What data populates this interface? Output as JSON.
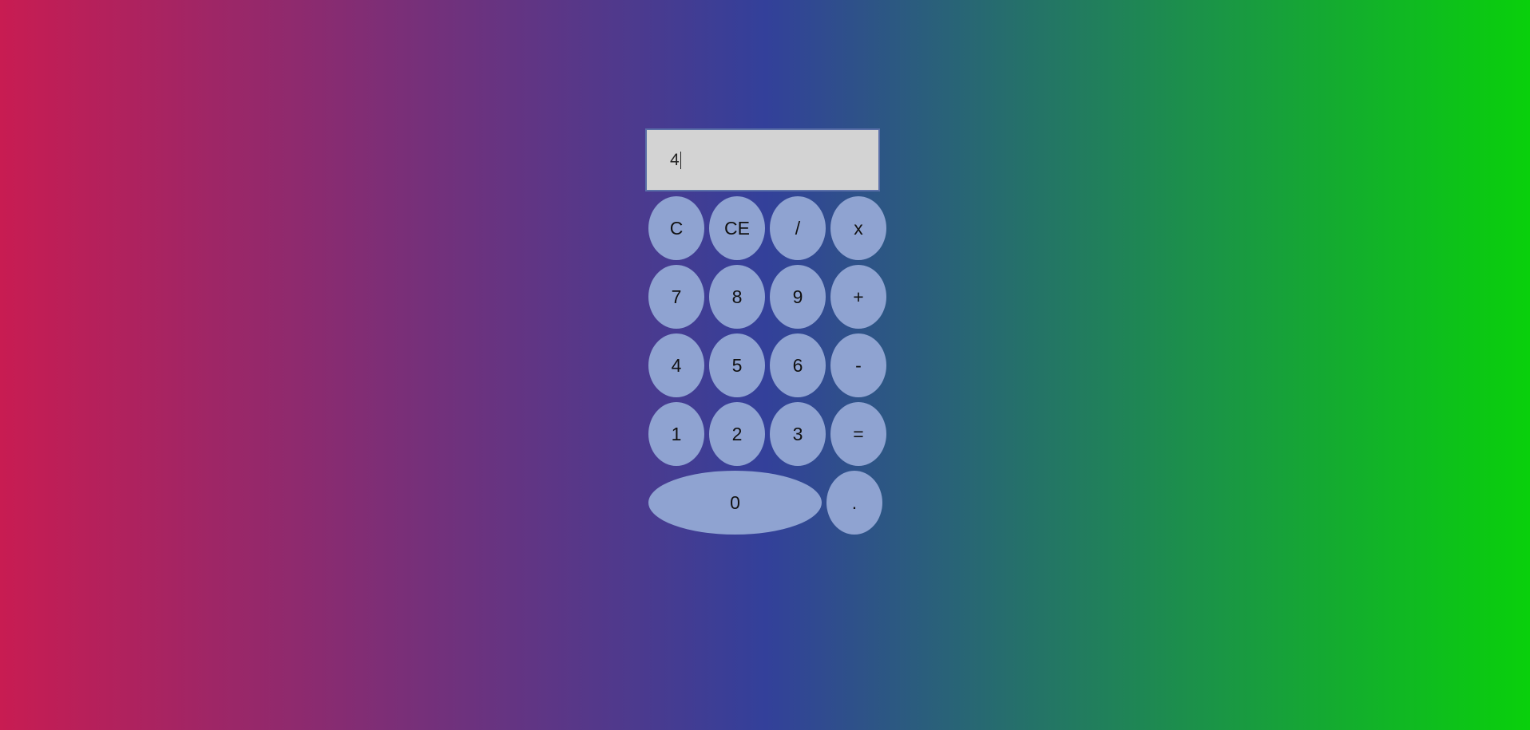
{
  "display": {
    "value": "4"
  },
  "keys": {
    "clear": "C",
    "clear_entry": "CE",
    "divide": "/",
    "multiply": "x",
    "seven": "7",
    "eight": "8",
    "nine": "9",
    "plus": "+",
    "four": "4",
    "five": "5",
    "six": "6",
    "minus": "-",
    "one": "1",
    "two": "2",
    "three": "3",
    "equals": "=",
    "zero": "0",
    "decimal": "."
  },
  "colors": {
    "gradient_left": "#c81c52",
    "gradient_mid": "#33409a",
    "gradient_right": "#09d00b",
    "key_fill": "#8fa3d1",
    "display_fill": "#d3d3d3"
  }
}
